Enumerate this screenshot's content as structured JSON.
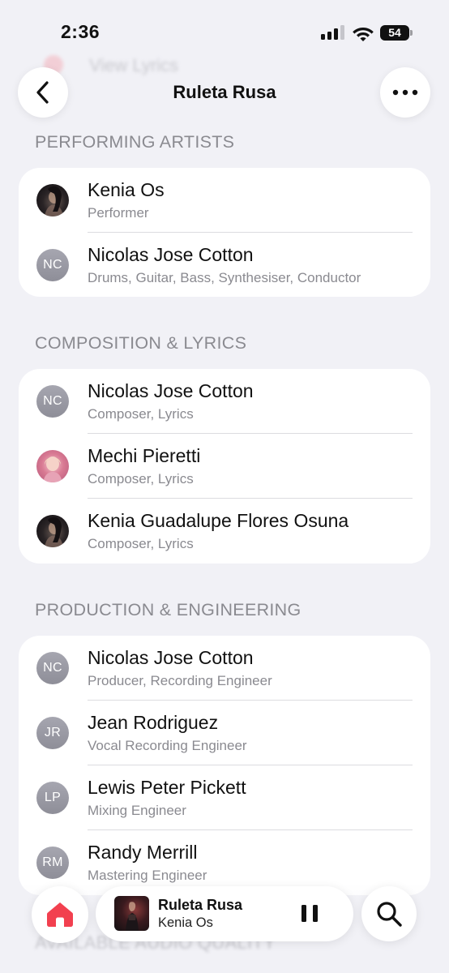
{
  "status_bar": {
    "time": "2:36",
    "battery": "54",
    "signal_bars_active": 3,
    "signal_bars_total": 4
  },
  "background": {
    "ghost_label": "View Lyrics",
    "ghost_bottom_header": "AVAILABLE AUDIO QUALITY"
  },
  "nav": {
    "title": "Ruleta Rusa",
    "back_icon": "chevron-left-icon",
    "more_icon": "ellipsis-icon"
  },
  "sections": [
    {
      "header": "PERFORMING ARTISTS",
      "rows": [
        {
          "name": "Kenia Os",
          "role": "Performer",
          "avatar": "photo-dark",
          "initials": ""
        },
        {
          "name": "Nicolas Jose Cotton",
          "role": "Drums, Guitar, Bass, Synthesiser, Conductor",
          "avatar": "initials",
          "initials": "NC"
        }
      ]
    },
    {
      "header": "COMPOSITION & LYRICS",
      "rows": [
        {
          "name": "Nicolas Jose Cotton",
          "role": "Composer, Lyrics",
          "avatar": "initials",
          "initials": "NC"
        },
        {
          "name": "Mechi Pieretti",
          "role": "Composer, Lyrics",
          "avatar": "photo-pink",
          "initials": ""
        },
        {
          "name": "Kenia Guadalupe Flores Osuna",
          "role": "Composer, Lyrics",
          "avatar": "photo-dark",
          "initials": ""
        }
      ]
    },
    {
      "header": "PRODUCTION & ENGINEERING",
      "rows": [
        {
          "name": "Nicolas Jose Cotton",
          "role": "Producer, Recording Engineer",
          "avatar": "initials",
          "initials": "NC"
        },
        {
          "name": "Jean Rodriguez",
          "role": "Vocal Recording Engineer",
          "avatar": "initials",
          "initials": "JR"
        },
        {
          "name": "Lewis Peter Pickett",
          "role": "Mixing Engineer",
          "avatar": "initials",
          "initials": "LP"
        },
        {
          "name": "Randy Merrill",
          "role": "Mastering Engineer",
          "avatar": "initials",
          "initials": "RM"
        }
      ]
    }
  ],
  "player": {
    "title": "Ruleta Rusa",
    "artist": "Kenia Os",
    "pause_icon": "pause-icon"
  },
  "tabs": {
    "home_icon": "home-icon",
    "search_icon": "search-icon"
  },
  "colors": {
    "background": "#f1f1f6",
    "card": "#ffffff",
    "secondary_text": "#8a8a90",
    "accent": "#f2404f"
  }
}
